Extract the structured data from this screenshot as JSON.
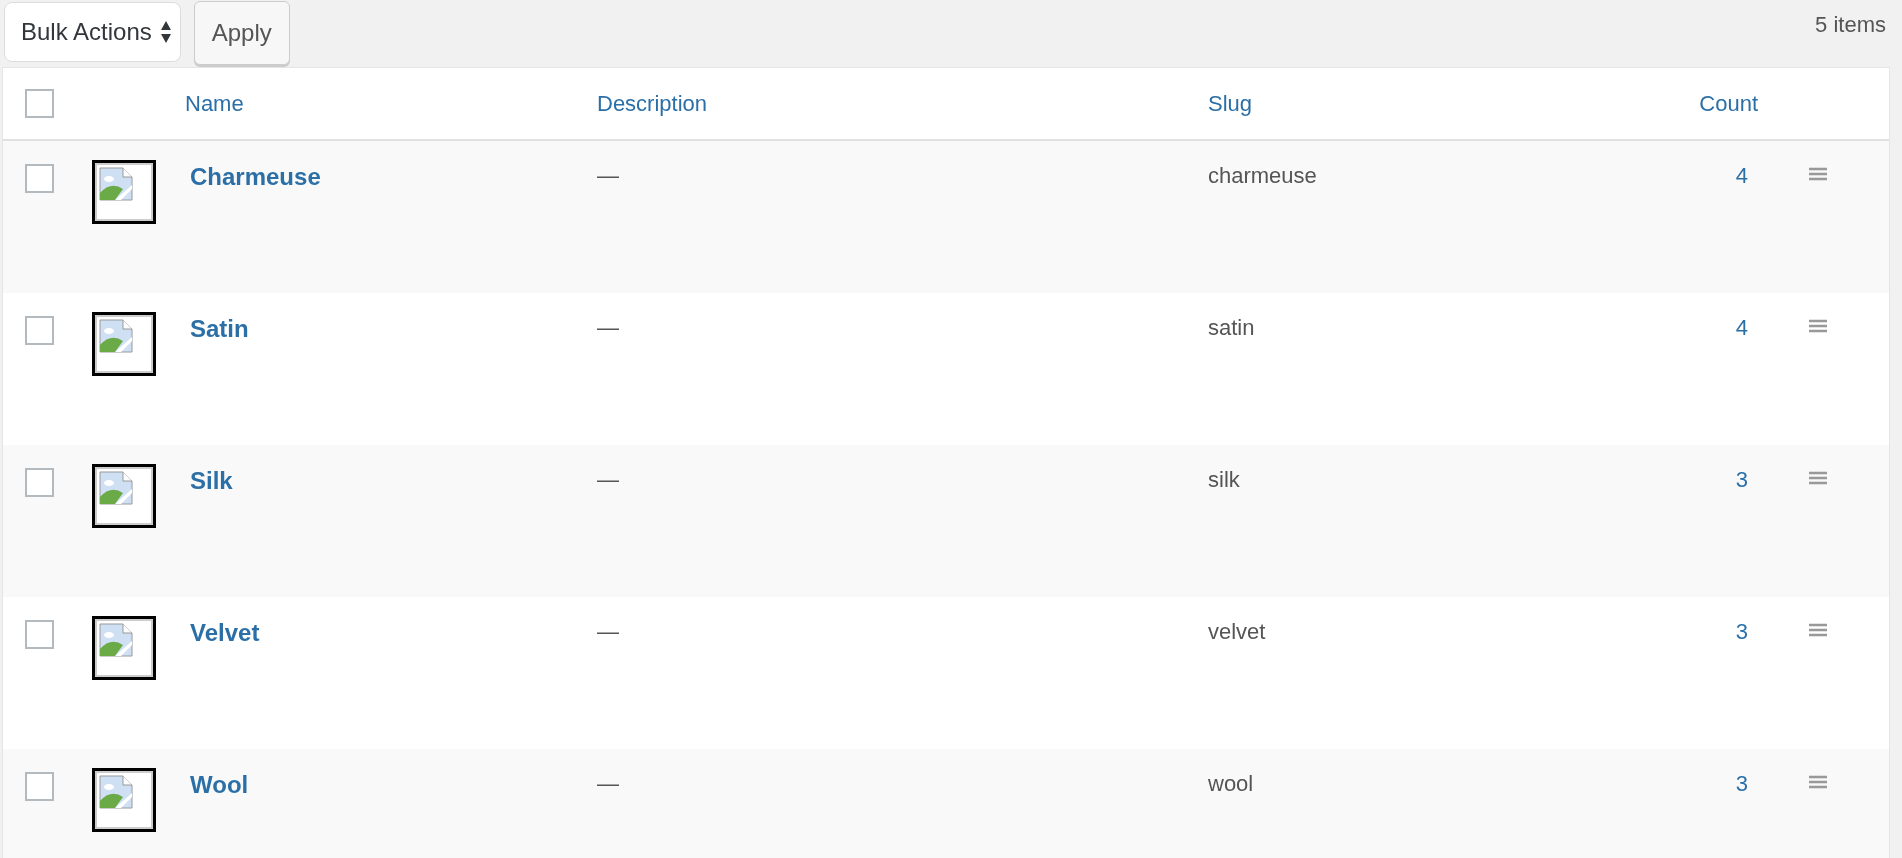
{
  "toolbar": {
    "bulk_actions": {
      "value": "Bulk Actions"
    },
    "apply_button": "Apply",
    "item_count": "5 items"
  },
  "table": {
    "select_all": {
      "checked": false
    },
    "columns": [
      "Name",
      "Description",
      "Slug",
      "Count"
    ],
    "rows": [
      {
        "name": "Charmeuse",
        "description": "—",
        "slug": "charmeuse",
        "count": "4",
        "checked": false
      },
      {
        "name": "Satin",
        "description": "—",
        "slug": "satin",
        "count": "4",
        "checked": false
      },
      {
        "name": "Silk",
        "description": "—",
        "slug": "silk",
        "count": "3",
        "checked": false
      },
      {
        "name": "Velvet",
        "description": "—",
        "slug": "velvet",
        "count": "3",
        "checked": false
      },
      {
        "name": "Wool",
        "description": "—",
        "slug": "wool",
        "count": "3",
        "checked": false
      }
    ]
  }
}
